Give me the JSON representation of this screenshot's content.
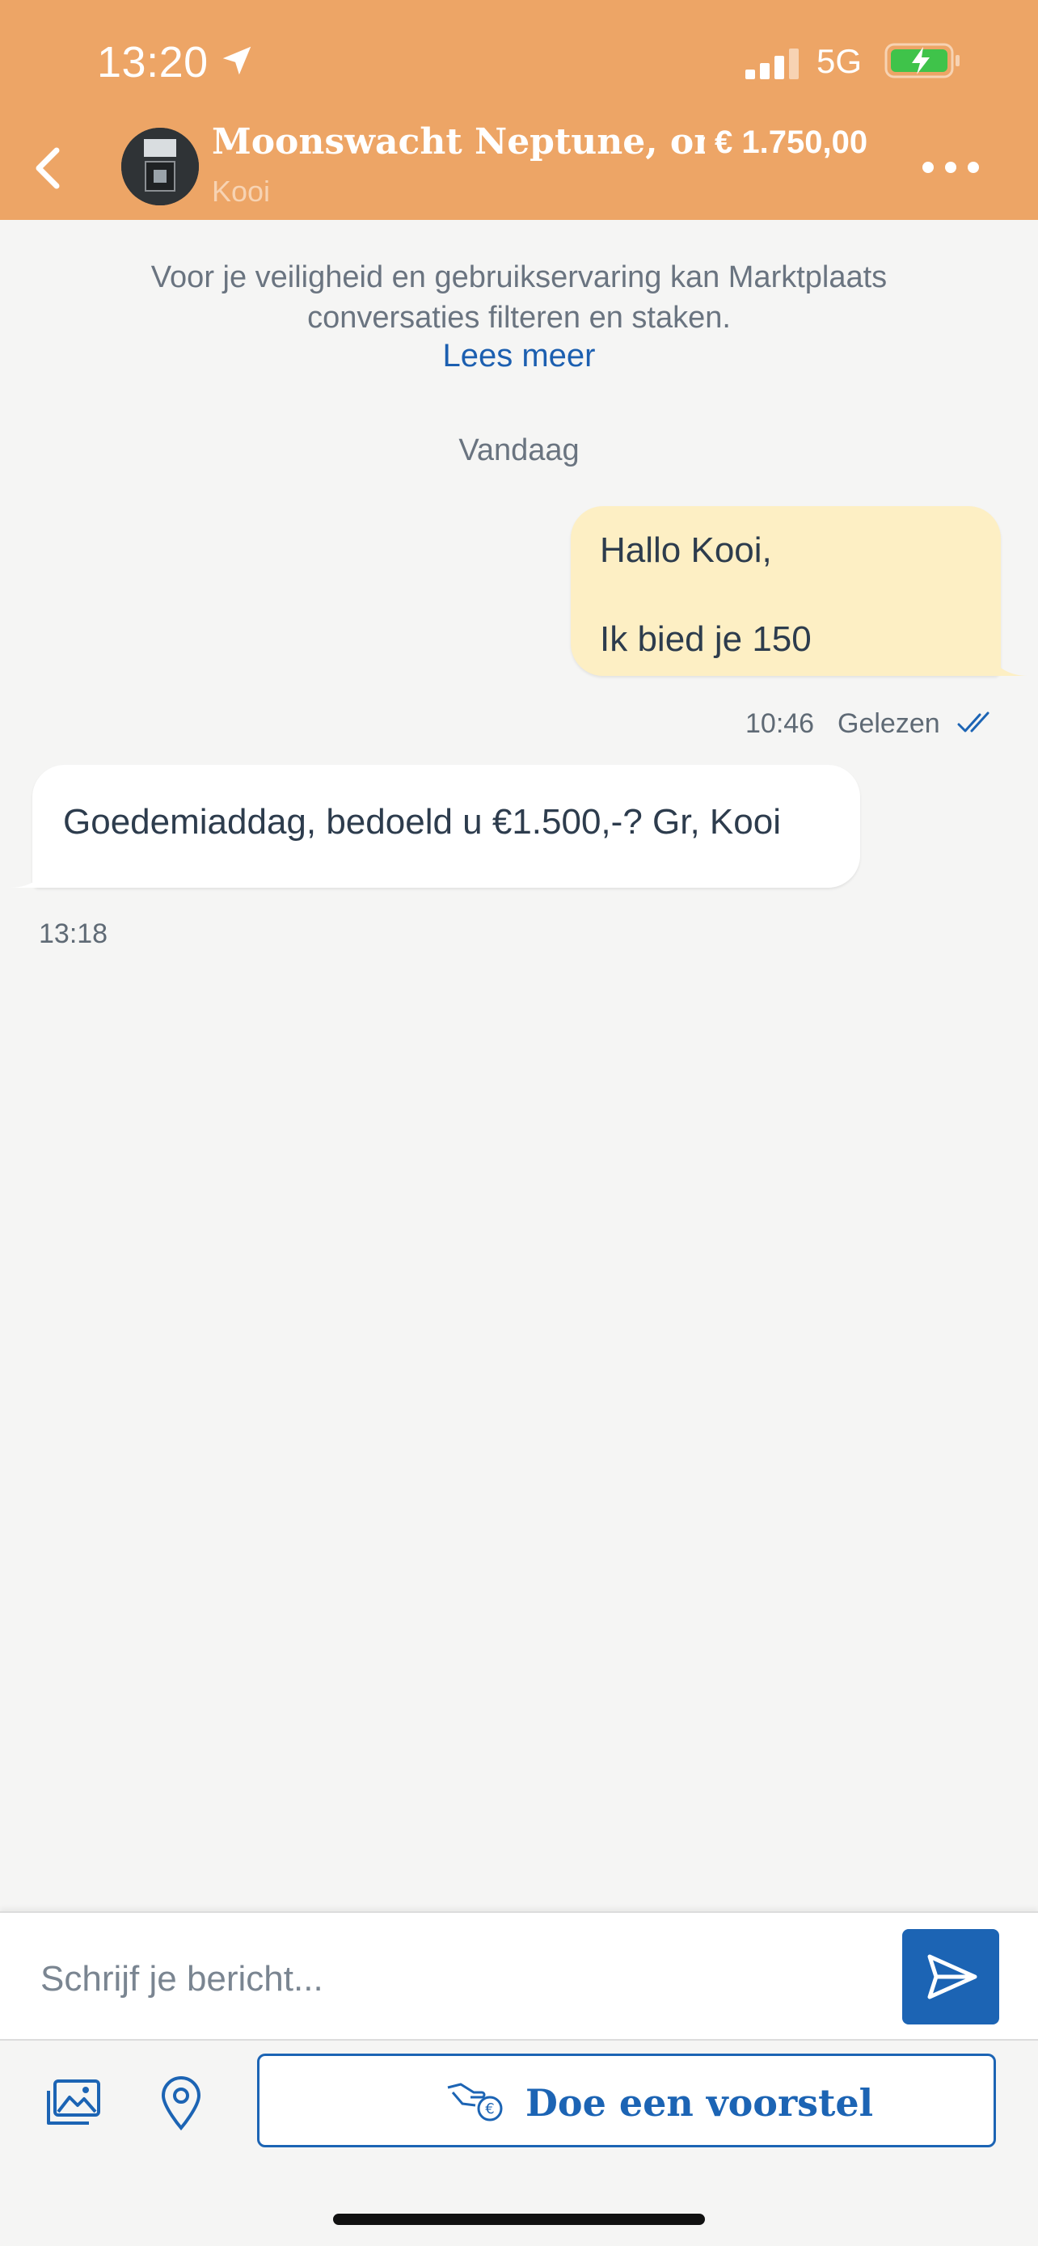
{
  "status_bar": {
    "time": "13:20",
    "network": "5G"
  },
  "header": {
    "title": "Moonswacht Neptune, ong...",
    "seller": "Kooi",
    "price": "€ 1.750,00"
  },
  "notice": {
    "text": "Voor je veiligheid en gebruikservaring kan Marktplaats conversaties filteren en staken.",
    "link": "Lees meer"
  },
  "date_separator": "Vandaag",
  "messages": [
    {
      "direction": "outgoing",
      "lines": [
        "Hallo Kooi,",
        "Ik bied je 150"
      ],
      "time": "10:46",
      "status": "Gelezen"
    },
    {
      "direction": "incoming",
      "text": "Goedemiaddag, bedoeld u €1.500,-? Gr, Kooi",
      "time": "13:18"
    }
  ],
  "composer": {
    "placeholder": "Schrijf je bericht..."
  },
  "actions": {
    "offer_label": "Doe een voorstel"
  },
  "colors": {
    "header": "#eda566",
    "accent": "#1c64b4",
    "outgoing_bubble": "#fdefc4"
  }
}
